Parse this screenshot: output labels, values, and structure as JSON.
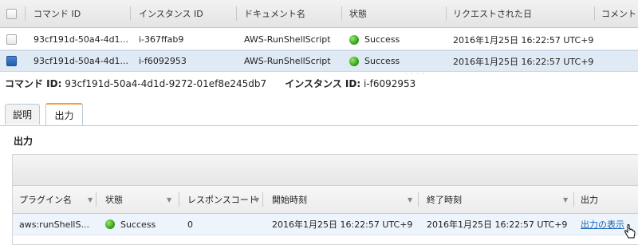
{
  "commands_table": {
    "headers": [
      "コマンド ID",
      "インスタンス ID",
      "ドキュメント名",
      "状態",
      "リクエストされた日",
      "コメント"
    ],
    "rows": [
      {
        "command_id": "93cf191d-50a4-4d1...",
        "instance_id": "i-367ffab9",
        "document": "AWS-RunShellScript",
        "status": "Success",
        "requested": "2016年1月25日  16:22:57 UTC+9",
        "selected": false
      },
      {
        "command_id": "93cf191d-50a4-4d1...",
        "instance_id": "i-f6092953",
        "document": "AWS-RunShellScript",
        "status": "Success",
        "requested": "2016年1月25日  16:22:57 UTC+9",
        "selected": true
      }
    ]
  },
  "detail": {
    "command_id_label": "コマンド ID:",
    "command_id_value": "93cf191d-50a4-4d1d-9272-01ef8e245db7",
    "instance_id_label": "インスタンス ID:",
    "instance_id_value": "i-f6092953"
  },
  "tabs": [
    {
      "label": "説明",
      "active": false
    },
    {
      "label": "出力",
      "active": true
    }
  ],
  "output": {
    "title": "出力",
    "headers": [
      "プラグイン名",
      "状態",
      "レスポンスコード",
      "開始時刻",
      "終了時刻",
      "出力"
    ],
    "row": {
      "plugin": "aws:runShellS...",
      "status": "Success",
      "response_code": "0",
      "start": "2016年1月25日  16:22:57 UTC+9",
      "end": "2016年1月25日  16:22:57 UTC+9",
      "link": "出力の表示"
    }
  },
  "colors": {
    "success": "#33a61a",
    "link": "#1a63b6",
    "selected_row": "#dfeaf5",
    "active_tab_accent": "#f0a030"
  }
}
